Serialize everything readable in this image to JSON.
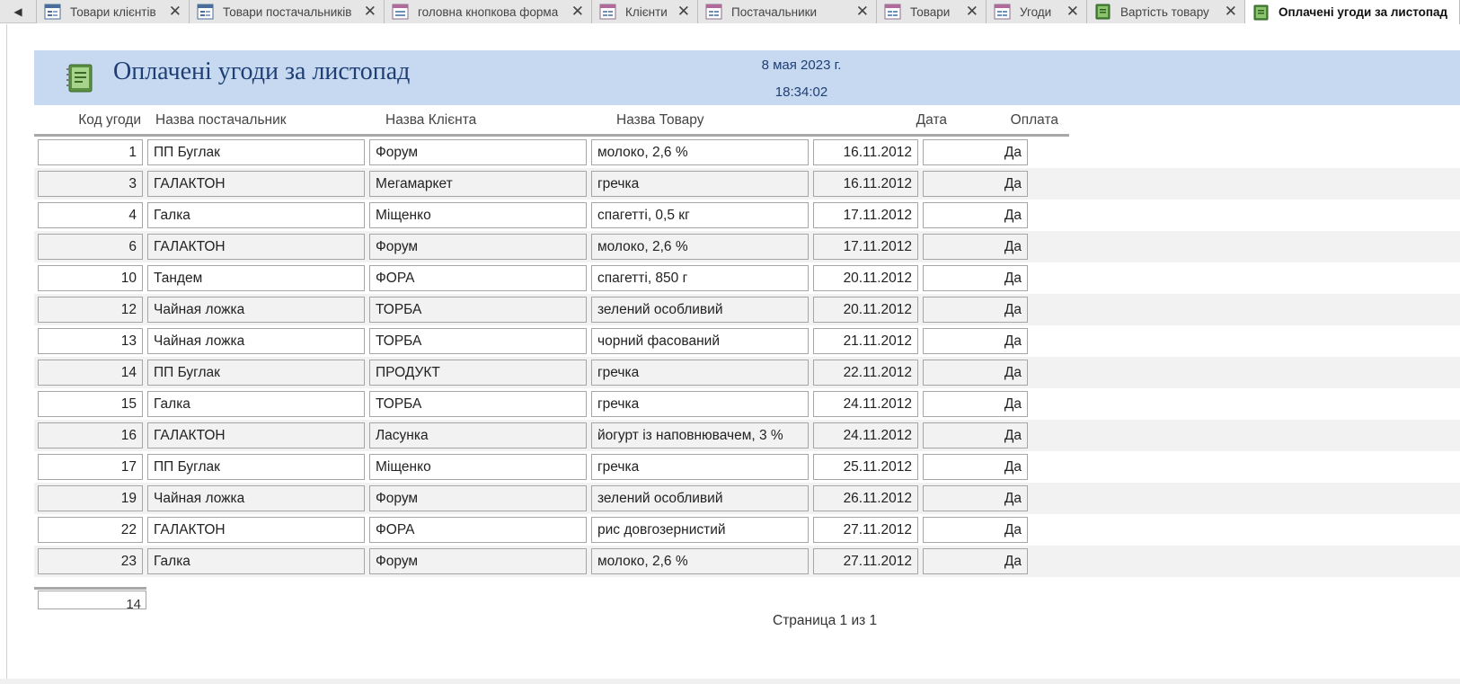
{
  "tabs": [
    {
      "label": "Товари клієнтів",
      "icon": "form-icon",
      "active": false
    },
    {
      "label": "Товари постачальників",
      "icon": "form-icon",
      "active": false
    },
    {
      "label": "головна кнопкова форма",
      "icon": "form-icon",
      "active": false
    },
    {
      "label": "Клієнти",
      "icon": "form-icon",
      "active": false
    },
    {
      "label": "Постачальники",
      "icon": "form-icon",
      "active": false
    },
    {
      "label": "Товари",
      "icon": "form-icon",
      "active": false
    },
    {
      "label": "Угоди",
      "icon": "form-icon",
      "active": false
    },
    {
      "label": "Вартість товару",
      "icon": "report-icon",
      "active": false
    },
    {
      "label": "Оплачені угоди за листопад",
      "icon": "report-icon",
      "active": true
    }
  ],
  "tab_close_glyph": "✕",
  "scroll_left_glyph": "◀",
  "report": {
    "title": "Оплачені угоди за листопад",
    "date": "8 мая 2023 г.",
    "time": "18:34:02",
    "columns": {
      "code": "Код угоди",
      "supplier": "Назва постачальник",
      "client": "Назва Клієнта",
      "product": "Назва Товару",
      "date": "Дата",
      "paid": "Оплата"
    },
    "rows": [
      {
        "code": "1",
        "supplier": "ПП Буглак",
        "client": "Форум",
        "product": "молоко, 2,6 %",
        "date": "16.11.2012",
        "paid": "Да"
      },
      {
        "code": "3",
        "supplier": "ГАЛАКТОН",
        "client": "Мегамаркет",
        "product": "гречка",
        "date": "16.11.2012",
        "paid": "Да"
      },
      {
        "code": "4",
        "supplier": "Галка",
        "client": "Міщенко",
        "product": "спагетті, 0,5 кг",
        "date": "17.11.2012",
        "paid": "Да"
      },
      {
        "code": "6",
        "supplier": "ГАЛАКТОН",
        "client": "Форум",
        "product": "молоко, 2,6 %",
        "date": "17.11.2012",
        "paid": "Да"
      },
      {
        "code": "10",
        "supplier": "Тандем",
        "client": "ФОРА",
        "product": "спагетті, 850 г",
        "date": "20.11.2012",
        "paid": "Да"
      },
      {
        "code": "12",
        "supplier": "Чайная ложка",
        "client": "ТОРБА",
        "product": "зелений особливий",
        "date": "20.11.2012",
        "paid": "Да"
      },
      {
        "code": "13",
        "supplier": "Чайная ложка",
        "client": "ТОРБА",
        "product": "чорний фасований",
        "date": "21.11.2012",
        "paid": "Да"
      },
      {
        "code": "14",
        "supplier": "ПП Буглак",
        "client": "ПРОДУКТ",
        "product": "гречка",
        "date": "22.11.2012",
        "paid": "Да"
      },
      {
        "code": "15",
        "supplier": "Галка",
        "client": "ТОРБА",
        "product": "гречка",
        "date": "24.11.2012",
        "paid": "Да"
      },
      {
        "code": "16",
        "supplier": "ГАЛАКТОН",
        "client": "Ласунка",
        "product": "йогурт із наповнювачем, 3 %",
        "date": "24.11.2012",
        "paid": "Да"
      },
      {
        "code": "17",
        "supplier": "ПП Буглак",
        "client": "Міщенко",
        "product": "гречка",
        "date": "25.11.2012",
        "paid": "Да"
      },
      {
        "code": "19",
        "supplier": "Чайная ложка",
        "client": "Форум",
        "product": "зелений особливий",
        "date": "26.11.2012",
        "paid": "Да"
      },
      {
        "code": "22",
        "supplier": "ГАЛАКТОН",
        "client": "ФОРА",
        "product": "рис довгозернистий",
        "date": "27.11.2012",
        "paid": "Да"
      },
      {
        "code": "23",
        "supplier": "Галка",
        "client": "Форум",
        "product": "молоко, 2,6 %",
        "date": "27.11.2012",
        "paid": "Да"
      }
    ],
    "total_count": "14",
    "page_footer": "Страница 1 из 1"
  },
  "colors": {
    "header_band": "#c6d9f0",
    "title_text": "#1f3f74",
    "alt_row": "#f2f2f2"
  }
}
